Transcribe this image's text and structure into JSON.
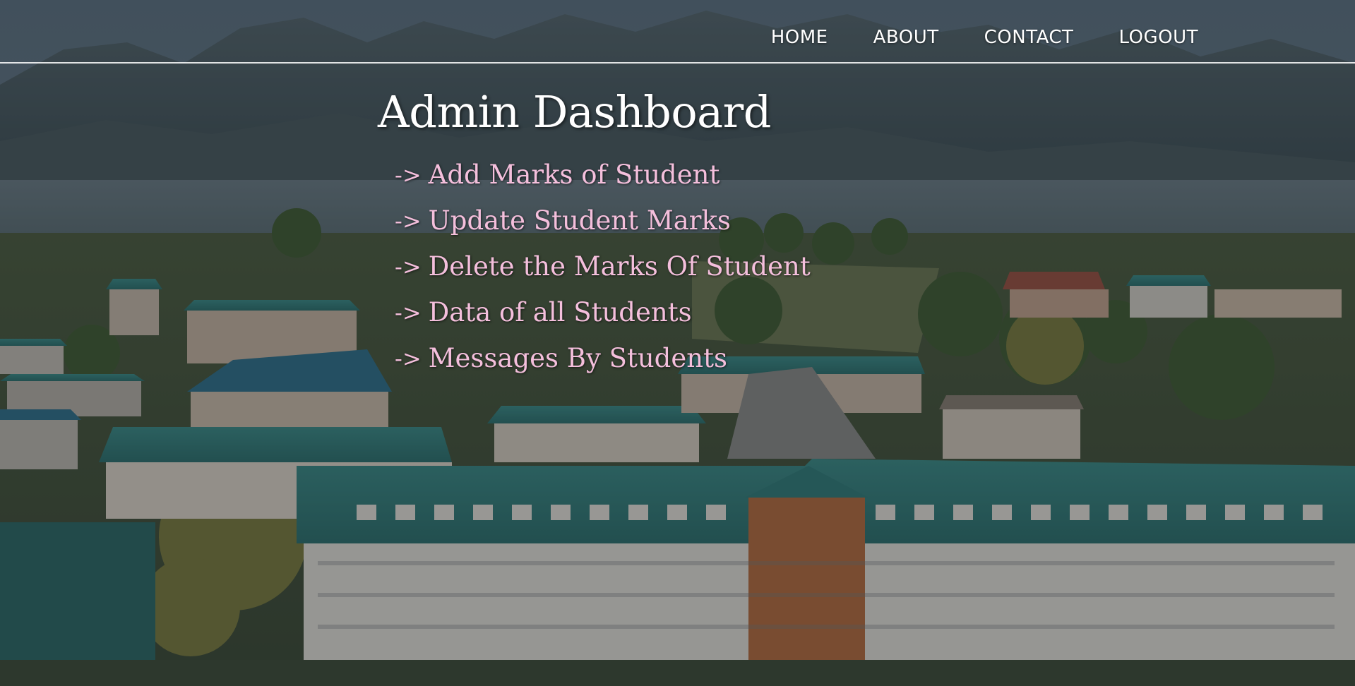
{
  "nav": {
    "items": [
      {
        "label": "HOME"
      },
      {
        "label": "ABOUT"
      },
      {
        "label": "CONTACT"
      },
      {
        "label": "LOGOUT"
      }
    ]
  },
  "main": {
    "title": "Admin Dashboard",
    "arrow": "->",
    "links": [
      {
        "label": "Add Marks of Student"
      },
      {
        "label": "Update Student Marks"
      },
      {
        "label": "Delete the Marks Of Student"
      },
      {
        "label": "Data of all Students"
      },
      {
        "label": "Messages By Students"
      }
    ]
  },
  "colors": {
    "link": "#f4bfdc",
    "title": "#ffffff",
    "nav_text": "#ffffff",
    "roof": "#2f7b78"
  }
}
